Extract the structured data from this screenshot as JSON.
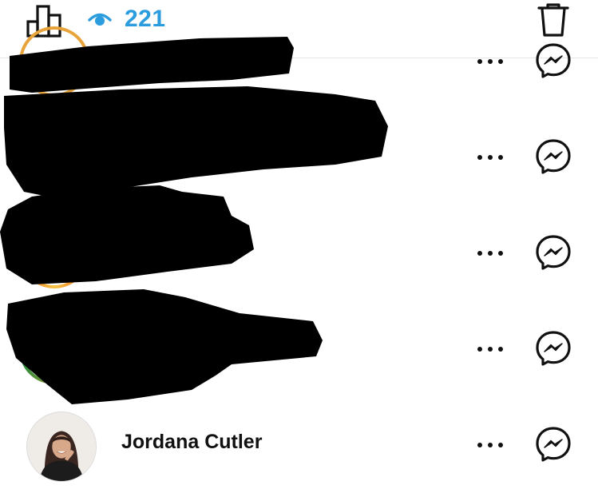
{
  "header": {
    "stats_icon": "bar-chart-icon",
    "views_icon": "eye-icon",
    "view_count": "221",
    "delete_icon": "trash-icon",
    "accent_color": "#2b9cdd"
  },
  "viewers": [
    {
      "name": "",
      "redacted": true,
      "more_icon": "more-options-icon",
      "message_icon": "messenger-icon"
    },
    {
      "name": "",
      "redacted": true,
      "more_icon": "more-options-icon",
      "message_icon": "messenger-icon"
    },
    {
      "name": "",
      "redacted": true,
      "more_icon": "more-options-icon",
      "message_icon": "messenger-icon"
    },
    {
      "name": "",
      "redacted": true,
      "more_icon": "more-options-icon",
      "message_icon": "messenger-icon"
    },
    {
      "name": "Jordana Cutler",
      "redacted": false,
      "more_icon": "more-options-icon",
      "message_icon": "messenger-icon"
    }
  ]
}
